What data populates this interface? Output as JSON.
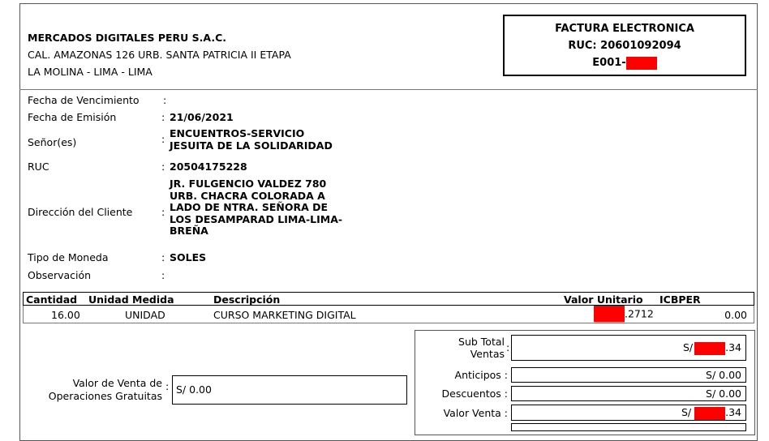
{
  "issuer": {
    "name": "MERCADOS DIGITALES PERU S.A.C.",
    "address1": "CAL. AMAZONAS 126 URB. SANTA PATRICIA II ETAPA",
    "address2": "LA MOLINA - LIMA - LIMA"
  },
  "doc": {
    "type": "FACTURA ELECTRONICA",
    "ruc": "RUC: 20601092094",
    "serie": "E001-"
  },
  "fields": {
    "vencimiento_label": "Fecha de Vencimiento",
    "vencimiento_value": "",
    "emision_label": "Fecha de Emisión",
    "emision_value": "21/06/2021",
    "senor_label": "Señor(es)",
    "senor_value_1": "ENCUENTROS-SERVICIO",
    "senor_value_2": "JESUITA DE LA SOLIDARIDAD",
    "ruc_label": "RUC",
    "ruc_value": "20504175228",
    "direccion_label": "Dirección del Cliente",
    "direccion_value_1": "JR. FULGENCIO VALDEZ 780",
    "direccion_value_2": "URB. CHACRA COLORADA A",
    "direccion_value_3": "LADO DE NTRA. SEÑORA DE",
    "direccion_value_4": "LOS DESAMPARAD LIMA-LIMA-",
    "direccion_value_5": "BREÑA",
    "moneda_label": "Tipo de Moneda",
    "moneda_value": "SOLES",
    "observacion_label": "Observación",
    "observacion_value": "",
    "colon": ":"
  },
  "table": {
    "headers": [
      "Cantidad",
      "Unidad Medida",
      "Descripción",
      "Valor Unitario",
      "ICBPER"
    ],
    "row": {
      "cantidad": "16.00",
      "unidad": "UNIDAD",
      "descripcion": "CURSO MARKETING DIGITAL",
      "valor_unitario_suffix": ".2712",
      "icbper": "0.00"
    }
  },
  "gratuitas": {
    "label_1": "Valor de Venta de",
    "label_2": "Operaciones Gratuitas",
    "value": "S/ 0.00"
  },
  "totals": {
    "subtotal_label_1": "Sub Total",
    "subtotal_label_2": "Ventas",
    "subtotal_prefix": "S/",
    "subtotal_suffix": ".34",
    "anticipos_label": "Anticipos :",
    "anticipos_value": "S/ 0.00",
    "descuentos_label": "Descuentos :",
    "descuentos_value": "S/ 0.00",
    "valorventa_label": "Valor Venta :",
    "valorventa_prefix": "S/",
    "valorventa_suffix": ".34"
  },
  "colors": {
    "redaction": "#ff0000",
    "border": "#000000"
  }
}
